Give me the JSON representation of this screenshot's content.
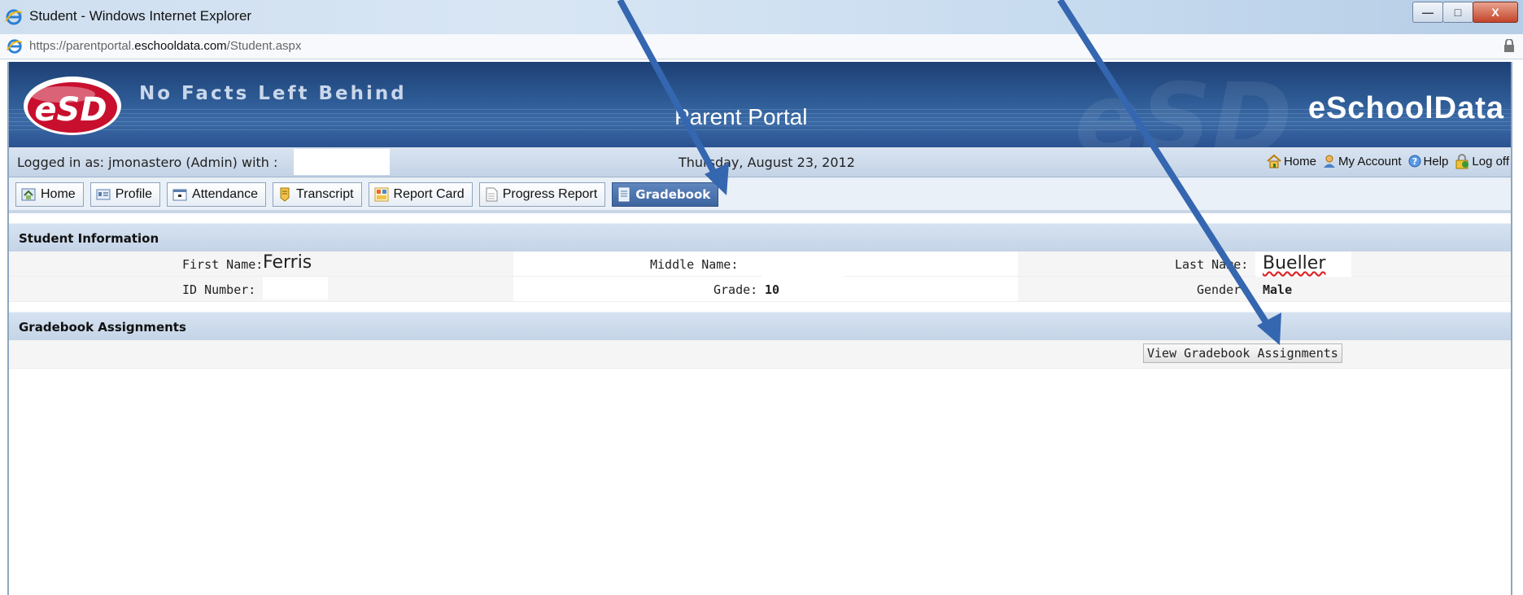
{
  "window": {
    "title": "Student - Windows Internet Explorer",
    "url_scheme": "https://",
    "url_host_prefix": "parentportal.",
    "url_host": "eschooldata.com",
    "url_path": "/Student.aspx",
    "minimize": "—",
    "maximize": "□",
    "close": "X"
  },
  "banner": {
    "logo_text": "eSD",
    "slogan": "No Facts Left Behind",
    "portal_title": "Parent Portal",
    "brand": "eSchoolData",
    "watermark": "eSD"
  },
  "status": {
    "logged_in": "Logged in as: jmonastero (Admin) with :",
    "date": "Thursday, August 23, 2012",
    "links": [
      {
        "label": "Home",
        "icon": "house-icon"
      },
      {
        "label": "My Account",
        "icon": "person-icon"
      },
      {
        "label": "Help",
        "icon": "help-icon"
      },
      {
        "label": "Log off",
        "icon": "lock-icon"
      }
    ]
  },
  "tabs": [
    {
      "label": "Home",
      "icon": "home-icon",
      "active": false
    },
    {
      "label": "Profile",
      "icon": "profile-card-icon",
      "active": false
    },
    {
      "label": "Attendance",
      "icon": "calendar-icon",
      "active": false
    },
    {
      "label": "Transcript",
      "icon": "transcript-icon",
      "active": false
    },
    {
      "label": "Report Card",
      "icon": "report-card-icon",
      "active": false
    },
    {
      "label": "Progress Report",
      "icon": "document-icon",
      "active": false
    },
    {
      "label": "Gradebook",
      "icon": "gradebook-icon",
      "active": true
    }
  ],
  "student_info": {
    "header": "Student Information",
    "first_name_label": "First Name:",
    "first_name": "Ferris",
    "middle_name_label": "Middle Name:",
    "last_name_label": "Last Name:",
    "last_name": "Bueller",
    "id_label": "ID Number:",
    "grade_label": "Grade:",
    "grade": "10",
    "gender_label": "Gender:",
    "gender": "Male"
  },
  "gradebook": {
    "header": "Gradebook Assignments",
    "view_button": "View Gradebook Assignments"
  },
  "colors": {
    "banner": "#2e5b95",
    "arrow": "#3566b0",
    "active_tab": "#4a72ad"
  }
}
